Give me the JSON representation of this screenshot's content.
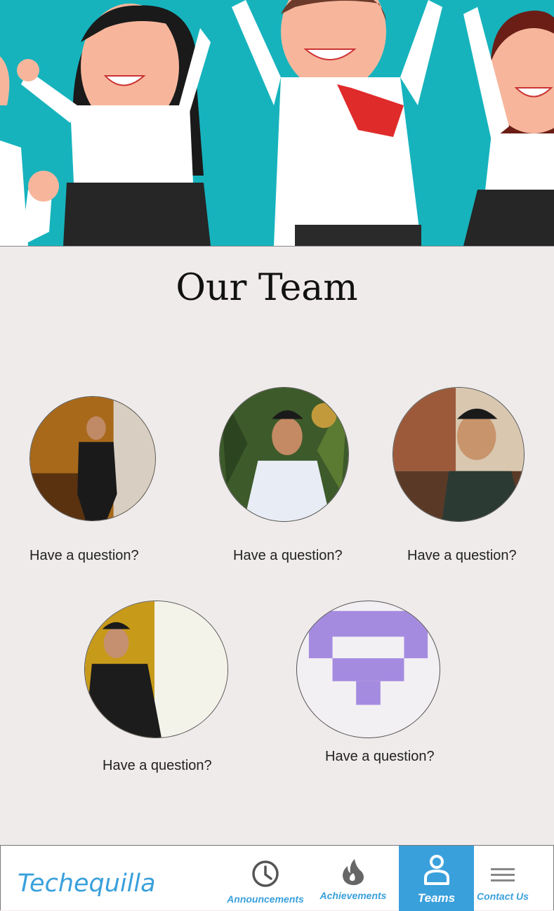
{
  "page": {
    "title": "Our Team"
  },
  "team": [
    {
      "id": "m1",
      "caption": "Have a question?"
    },
    {
      "id": "m2",
      "caption": "Have a question?"
    },
    {
      "id": "m3",
      "caption": "Have a question?"
    },
    {
      "id": "m4",
      "caption": "Have a question?"
    },
    {
      "id": "m5",
      "caption": "Have a question?"
    }
  ],
  "nav": {
    "brand": "Techequilla",
    "items": [
      {
        "label": "Announcements",
        "icon": "clock-icon",
        "active": false
      },
      {
        "label": "Achievements",
        "icon": "flame-icon",
        "active": false
      },
      {
        "label": "Teams",
        "icon": "person-icon",
        "active": true
      },
      {
        "label": "Contact Us",
        "icon": "menu-icon",
        "active": false
      }
    ]
  },
  "colors": {
    "accent": "#3aa0dc",
    "hero_background": "#16b3bd",
    "page_background": "#efebea",
    "placeholder_avatar": "#a58be0"
  }
}
